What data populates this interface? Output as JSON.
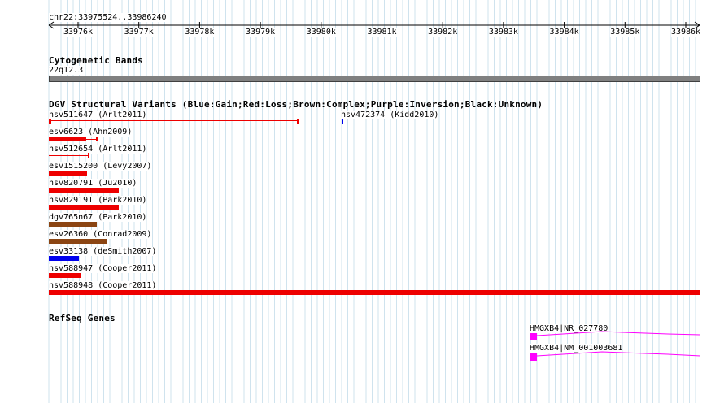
{
  "header": {
    "location": "chr22:33975524..33986240"
  },
  "ruler": {
    "ticks": [
      "33976k",
      "33977k",
      "33978k",
      "33979k",
      "33980k",
      "33981k",
      "33982k",
      "33983k",
      "33984k",
      "33985k",
      "33986k"
    ]
  },
  "cytoband": {
    "title": "Cytogenetic Bands",
    "band": "22q12.3"
  },
  "dgv": {
    "title": "DGV Structural Variants (Blue:Gain;Red:Loss;Brown:Complex;Purple:Inversion;Black:Unknown)",
    "variants": [
      {
        "label": "nsv511647 (Arlt2011)",
        "color": "#ee0000",
        "kind": "thin"
      },
      {
        "label": "nsv472374 (Kidd2010)",
        "color": "#0000ee",
        "kind": "tick"
      },
      {
        "label": "esv6623 (Ahn2009)",
        "color": "#ee0000",
        "kind": "thick+line"
      },
      {
        "label": "nsv512654 (Arlt2011)",
        "color": "#ee0000",
        "kind": "thin"
      },
      {
        "label": "esv1515200 (Levy2007)",
        "color": "#ee0000",
        "kind": "thick"
      },
      {
        "label": "nsv820791 (Ju2010)",
        "color": "#ee0000",
        "kind": "thick"
      },
      {
        "label": "nsv829191 (Park2010)",
        "color": "#ee0000",
        "kind": "thick"
      },
      {
        "label": "dgv765n67 (Park2010)",
        "color": "#8b4513",
        "kind": "thick"
      },
      {
        "label": "esv26360 (Conrad2009)",
        "color": "#8b4513",
        "kind": "thick"
      },
      {
        "label": "esv33138 (deSmith2007)",
        "color": "#0000ee",
        "kind": "thick"
      },
      {
        "label": "nsv588947 (Cooper2011)",
        "color": "#ee0000",
        "kind": "thick"
      },
      {
        "label": "nsv588948 (Cooper2011)",
        "color": "#ee0000",
        "kind": "thick"
      }
    ]
  },
  "refseq": {
    "title": "RefSeq Genes",
    "genes": [
      {
        "label": "HMGXB4|NR_027780",
        "color": "#ff00ff"
      },
      {
        "label": "HMGXB4|NM_001003681",
        "color": "#ff00ff"
      }
    ]
  }
}
